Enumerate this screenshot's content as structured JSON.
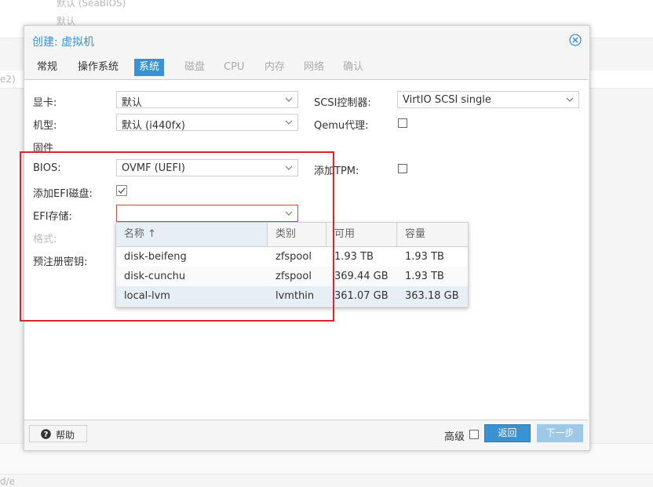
{
  "background": {
    "items": [
      "默认 (SeaBIOS)",
      "默认",
      "e2)",
      "d/e"
    ]
  },
  "dialog": {
    "title": "创建: 虚拟机",
    "close_icon": "close-circle-icon",
    "tabs": [
      {
        "label": "常规",
        "state": "enabled"
      },
      {
        "label": "操作系统",
        "state": "enabled"
      },
      {
        "label": "系统",
        "state": "active"
      },
      {
        "label": "磁盘",
        "state": "disabled"
      },
      {
        "label": "CPU",
        "state": "disabled"
      },
      {
        "label": "内存",
        "state": "disabled"
      },
      {
        "label": "网络",
        "state": "disabled"
      },
      {
        "label": "确认",
        "state": "disabled"
      }
    ],
    "form": {
      "graphics_label": "显卡:",
      "graphics_value": "默认",
      "machine_label": "机型:",
      "machine_value": "默认 (i440fx)",
      "firmware_label": "固件",
      "bios_label": "BIOS:",
      "bios_value": "OVMF (UEFI)",
      "add_efi_label": "添加EFI磁盘:",
      "add_efi_checked": true,
      "efi_storage_label": "EFI存储:",
      "efi_storage_value": "",
      "format_label": "格式:",
      "preenrolled_label": "预注册密钥:",
      "scsi_label": "SCSI控制器:",
      "scsi_value": "VirtIO SCSI single",
      "qemu_agent_label": "Qemu代理:",
      "qemu_agent_checked": false,
      "add_tpm_label": "添加TPM:",
      "add_tpm_checked": false
    },
    "storage_dropdown": {
      "columns": [
        "名称 ↑",
        "类别",
        "可用",
        "容量"
      ],
      "rows": [
        {
          "name": "disk-beifeng",
          "type": "zfspool",
          "avail": "1.93 TB",
          "capacity": "1.93 TB"
        },
        {
          "name": "disk-cunchu",
          "type": "zfspool",
          "avail": "369.44 GB",
          "capacity": "1.93 TB"
        },
        {
          "name": "local-lvm",
          "type": "lvmthin",
          "avail": "361.07 GB",
          "capacity": "363.18 GB"
        }
      ]
    },
    "footer": {
      "help_label": "帮助",
      "advanced_label": "高级",
      "advanced_checked": false,
      "back_label": "返回",
      "next_label": "下一步"
    }
  },
  "colors": {
    "accent": "#3892d4",
    "annotation_border": "#d9252a",
    "invalid_border": "#cf4c35"
  }
}
